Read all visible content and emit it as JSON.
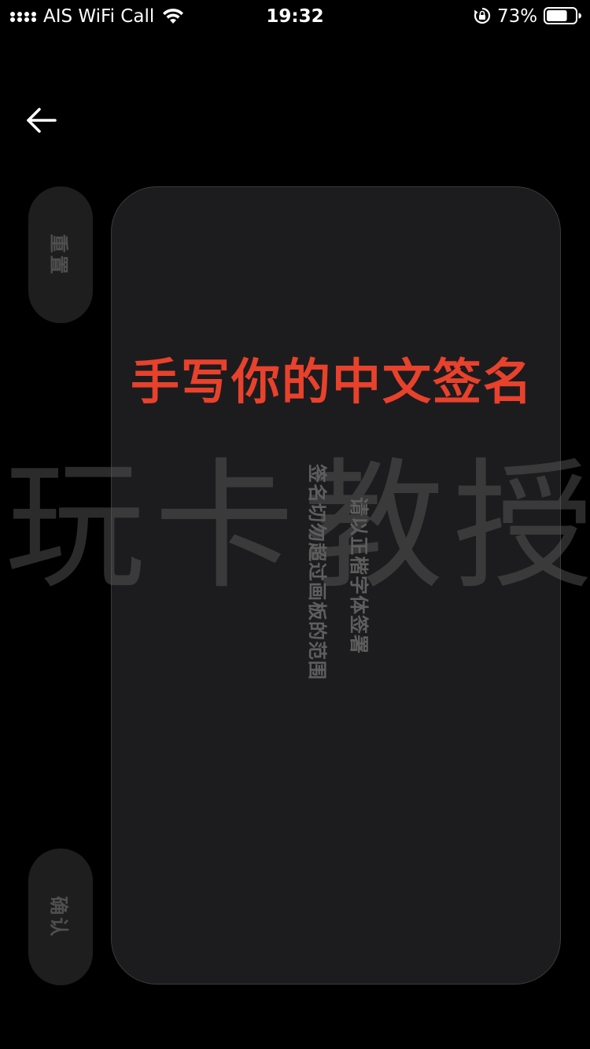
{
  "status_bar": {
    "carrier": "AIS WiFi Call",
    "time": "19:32",
    "battery_percent": "73%",
    "battery_level": 0.73
  },
  "nav": {
    "back_icon": "arrow-left-icon"
  },
  "buttons": {
    "reset_label": "重置",
    "confirm_label": "确认"
  },
  "overlay": {
    "headline": "手写你的中文签名",
    "watermark": "玩卡教授"
  },
  "signature_pad": {
    "hint_line_1": "请以正楷字体签署",
    "hint_line_2": "签名切勿超过画板的范围"
  },
  "colors": {
    "background": "#000000",
    "pad": "#1c1c1e",
    "headline": "#e8412c",
    "button": "#1e1e1e",
    "button_text": "#4f4f4f"
  }
}
